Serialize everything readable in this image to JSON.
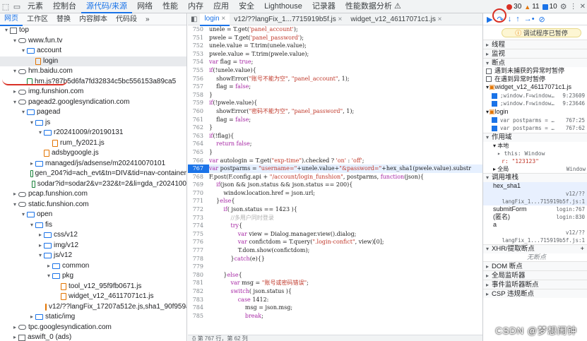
{
  "topbar": {
    "tabs": [
      "元素",
      "控制台",
      "源代码/来源",
      "网络",
      "性能",
      "内存",
      "应用",
      "安全",
      "Lighthouse",
      "记录器",
      "性能数据分析 ⚠"
    ],
    "active_tab": "源代码/来源",
    "errors": "30",
    "warnings": "11",
    "info": "10"
  },
  "left": {
    "subtabs": [
      "网页",
      "工作区",
      "替换",
      "内容脚本",
      "代码段"
    ],
    "tree": [
      {
        "d": 0,
        "t": "frame",
        "tri": "▾",
        "label": "top"
      },
      {
        "d": 1,
        "t": "cloud",
        "tri": "▾",
        "label": "www.fun.tv"
      },
      {
        "d": 2,
        "t": "folder",
        "tri": "▾",
        "label": "account"
      },
      {
        "d": 3,
        "t": "file",
        "tri": "",
        "label": "login",
        "sel": true
      },
      {
        "d": 1,
        "t": "cloud",
        "tri": "▾",
        "label": "hm.baidu.com"
      },
      {
        "d": 2,
        "t": "file g",
        "tri": "",
        "label": "hm.js?87b5d6fa7fd32834c5bc556153a89ca5"
      },
      {
        "d": 1,
        "t": "cloud",
        "tri": "▸",
        "label": "img.funshion.com"
      },
      {
        "d": 1,
        "t": "cloud",
        "tri": "▾",
        "label": "pagead2.googlesyndication.com"
      },
      {
        "d": 2,
        "t": "folder",
        "tri": "▾",
        "label": "pagead"
      },
      {
        "d": 3,
        "t": "folder",
        "tri": "▾",
        "label": "js"
      },
      {
        "d": 4,
        "t": "folder",
        "tri": "▾",
        "label": "r20241009/r20190131"
      },
      {
        "d": 5,
        "t": "file",
        "tri": "",
        "label": "rum_fy2021.js"
      },
      {
        "d": 4,
        "t": "file",
        "tri": "",
        "label": "adsbygoogle.js"
      },
      {
        "d": 3,
        "t": "folder",
        "tri": "▸",
        "label": "managed/js/adsense/m202410070101"
      },
      {
        "d": 3,
        "t": "file g",
        "tri": "",
        "label": "gen_204?id=ach_evt&tn=DIV&tid=nav-container"
      },
      {
        "d": 3,
        "t": "file g",
        "tri": "",
        "label": "sodar?id=sodar2&v=232&t=2&li=gda_r2024100"
      },
      {
        "d": 1,
        "t": "cloud",
        "tri": "▸",
        "label": "pcap.funshion.com"
      },
      {
        "d": 1,
        "t": "cloud",
        "tri": "▾",
        "label": "static.funshion.com"
      },
      {
        "d": 2,
        "t": "folder",
        "tri": "▾",
        "label": "open"
      },
      {
        "d": 3,
        "t": "folder",
        "tri": "▾",
        "label": "fis"
      },
      {
        "d": 4,
        "t": "folder",
        "tri": "▸",
        "label": "css/v12"
      },
      {
        "d": 4,
        "t": "folder",
        "tri": "▸",
        "label": "img/v12"
      },
      {
        "d": 4,
        "t": "folder",
        "tri": "▾",
        "label": "js/v12"
      },
      {
        "d": 5,
        "t": "folder",
        "tri": "▸",
        "label": "common"
      },
      {
        "d": 5,
        "t": "folder",
        "tri": "▾",
        "label": "pkg"
      },
      {
        "d": 6,
        "t": "file",
        "tri": "",
        "label": "tool_v12_95f9fb0671.js"
      },
      {
        "d": 6,
        "t": "file",
        "tri": "",
        "label": "widget_v12_46117071c1.js"
      },
      {
        "d": 5,
        "t": "file",
        "tri": "",
        "label": "v12/??langFix_17207a512e.js,sha1_90f959a43"
      },
      {
        "d": 3,
        "t": "folder",
        "tri": "▸",
        "label": "static/img"
      },
      {
        "d": 1,
        "t": "cloud",
        "tri": "▸",
        "label": "tpc.googlesyndication.com"
      },
      {
        "d": 1,
        "t": "frame",
        "tri": "▸",
        "label": "aswift_0 (ads)"
      }
    ]
  },
  "editor": {
    "tabs": [
      "login",
      "v12/??langFix_1...7715919b5f.js",
      "widget_v12_46117071c1.js"
    ],
    "active_tab": "login",
    "lines": [
      {
        "n": "750",
        "h": "unele = T.get(<span class=str>'panel_account'</span>);"
      },
      {
        "n": "751",
        "h": "pwele = T.get(<span class=str>'panel_password'</span>);"
      },
      {
        "n": "752",
        "h": "unele.value = T.trim(unele.value);"
      },
      {
        "n": "753",
        "h": "pwele.value = T.trim(pwele.value);"
      },
      {
        "n": "754",
        "h": "<span class=kw>var</span> flag = <span class=kw>true</span>;"
      },
      {
        "n": "755",
        "h": "<span class=kw>if</span>(!unele.value){"
      },
      {
        "n": "756",
        "h": "    showError(<span class=str>\"账号不能为空\"</span>, <span class=str>\"panel_account\"</span>, 1);"
      },
      {
        "n": "757",
        "h": "    flag = <span class=kw>false</span>;"
      },
      {
        "n": "758",
        "h": "}"
      },
      {
        "n": "759",
        "h": "<span class=kw>if</span>(!pwele.value){"
      },
      {
        "n": "760",
        "h": "    showError(<span class=str>\"密码不能为空\"</span>, <span class=str>\"panel_password\"</span>, 1);"
      },
      {
        "n": "761",
        "h": "    flag = <span class=kw>false</span>;"
      },
      {
        "n": "762",
        "h": "}"
      },
      {
        "n": "763",
        "h": "<span class=kw>if</span>(!flag){"
      },
      {
        "n": "764",
        "h": "    <span class=kw>return false</span>;"
      },
      {
        "n": "765",
        "h": "}"
      },
      {
        "n": "766",
        "h": "<span class=kw>var</span> autologin = T.get(<span class=str>\"exp-time\"</span>).checked ? <span class=str>'on'</span> : <span class=str>'off'</span>;"
      },
      {
        "n": "767",
        "h": "<span class=kw>var</span> postparms = <span class=str>\"username=\"</span>+unele.value+<span class=str>\"&password=\"</span>+hex_sha1(pwele.value).substr",
        "bp": true
      },
      {
        "n": "768",
        "h": "F.post(F.config.api + <span class=str>\"/account/login_funshion\"</span>, postparms, <span class=kw>function</span>(json){"
      },
      {
        "n": "769",
        "h": "    <span class=kw>if</span>(json && json.status && json.status == 200){"
      },
      {
        "n": "770",
        "h": "        window.location.href = json.url;"
      },
      {
        "n": "771",
        "h": "    }<span class=kw>else</span>{"
      },
      {
        "n": "772",
        "h": "        <span class=kw>if</span>( json.status == 1423 ){"
      },
      {
        "n": "773",
        "h": "            <span class=cm>//多用户同时登录</span>"
      },
      {
        "n": "774",
        "h": "            <span class=kw>try</span>{"
      },
      {
        "n": "775",
        "h": "                <span class=kw>var</span> view = Dialog.manager.view().dialog;"
      },
      {
        "n": "776",
        "h": "                <span class=kw>var</span> confictdom = T.query(<span class=str>\".login-confict\"</span>, view)[0];"
      },
      {
        "n": "777",
        "h": "                T.dom.show(confictdom);"
      },
      {
        "n": "778",
        "h": "            }<span class=kw>catch</span>(e){}"
      },
      {
        "n": "779",
        "h": ""
      },
      {
        "n": "780",
        "h": "        }<span class=kw>else</span>{"
      },
      {
        "n": "781",
        "h": "            <span class=kw>var</span> msg = <span class=str>\"账号或密码错误\"</span>;"
      },
      {
        "n": "782",
        "h": "            <span class=kw>switch</span>( json.status ){"
      },
      {
        "n": "783",
        "h": "                <span class=kw>case</span> 1412:"
      },
      {
        "n": "784",
        "h": "                    msg = json.msg;"
      },
      {
        "n": "785",
        "h": "                    <span class=kw>break</span>;"
      }
    ],
    "status": "{}  第 767 行，第 62 列"
  },
  "right": {
    "paused": "调试程序已暂停",
    "sections": {
      "threads": "线程",
      "watch": "监视",
      "breakpoints": "断点",
      "scope": "作用域",
      "callstack": "调用堆栈",
      "xhr": "XHR/提取断点",
      "dom": "DOM 断点",
      "global": "全局监听器",
      "event": "事件监听器断点",
      "csp": "CSP 违规断点"
    },
    "bp_options": [
      "遇到未捕获的异常时暂停",
      "在遇到异常时暂停"
    ],
    "bp_files": [
      {
        "file": "widget_v12_46117071c1.js",
        "items": [
          {
            "code": ";window.F=window…",
            "loc": "9:23609"
          },
          {
            "code": ";window.F=window…",
            "loc": "9:23646"
          }
        ]
      },
      {
        "file": "login",
        "items": [
          {
            "code": "var postparms = …",
            "loc": "767:25"
          },
          {
            "code": "var postparms = …",
            "loc": "767:62"
          }
        ]
      }
    ],
    "scope_local": "本地",
    "scope_this": "▸ this: Window",
    "scope_r": "r: \"123123\"",
    "scope_global": "全局",
    "scope_global_val": "Window",
    "stack": [
      {
        "fn": "hex_sha1",
        "loc": "v12/??langFix_1...715919b5f.js:1"
      },
      {
        "fn": "submitForm",
        "loc": "login:767"
      },
      {
        "fn": "(匿名)",
        "loc": "login:830"
      },
      {
        "fn": "a",
        "loc": "v12/??langFix_1...715919b5f.js:1"
      }
    ],
    "xhr_empty": "无断点"
  },
  "watermark": "CSDN @梦想闹钟"
}
